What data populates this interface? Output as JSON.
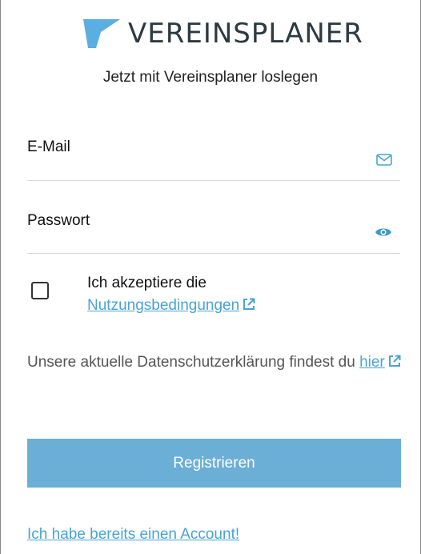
{
  "brand": {
    "name": "VEREINSPLANER",
    "logo_icon": "flag-logo-icon",
    "accent": "#4aa3d6"
  },
  "tagline": "Jetzt mit Vereinsplaner loslegen",
  "form": {
    "email_label": "E-Mail",
    "email_icon": "envelope-icon",
    "password_label": "Passwort",
    "password_icon": "eye-icon",
    "terms_text": "Ich akzeptiere die",
    "terms_link": "Nutzungsbedingungen",
    "privacy_text": "Unsere aktuelle Datenschutzerklärung findest du",
    "privacy_link": "hier",
    "submit_label": "Registrieren",
    "submit_color": "#6baed6",
    "login_link": "Ich habe bereits einen Account!"
  }
}
